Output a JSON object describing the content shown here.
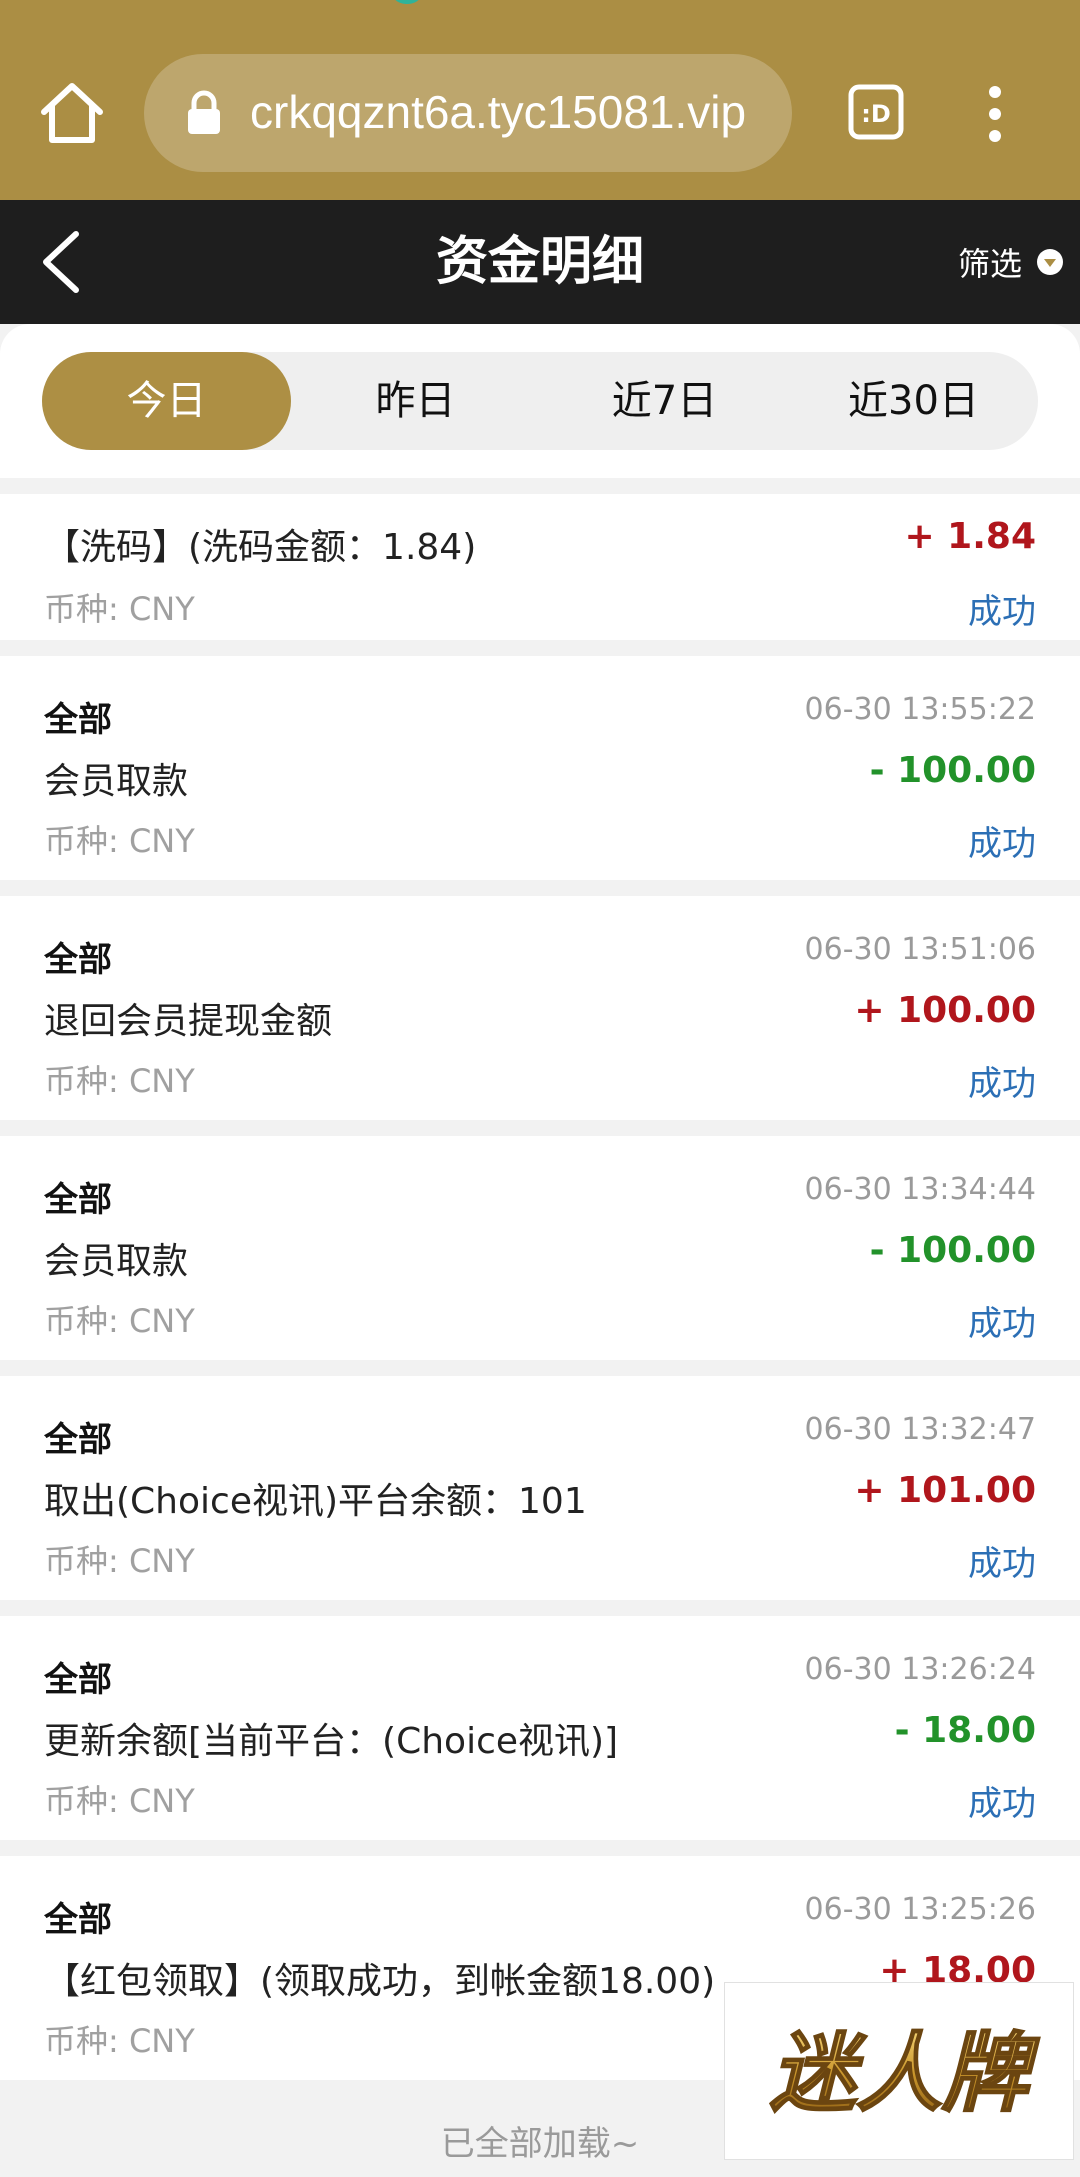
{
  "browser": {
    "url": "crkqqznt6a.tyc15081.vip"
  },
  "header": {
    "title": "资金明细",
    "filter_label": "筛选"
  },
  "tabs": [
    {
      "label": "今日",
      "active": true
    },
    {
      "label": "昨日",
      "active": false
    },
    {
      "label": "近7日",
      "active": false
    },
    {
      "label": "近30日",
      "active": false
    }
  ],
  "records": [
    {
      "type": "",
      "time": "",
      "desc": "【洗码】(洗码金额：1.84)",
      "amount": "+ 1.84",
      "sign": "pos",
      "currency": "币种: CNY",
      "status": "成功"
    },
    {
      "type": "全部",
      "time": "06-30 13:55:22",
      "desc": "会员取款",
      "amount": "- 100.00",
      "sign": "neg",
      "currency": "币种: CNY",
      "status": "成功"
    },
    {
      "type": "全部",
      "time": "06-30 13:51:06",
      "desc": "退回会员提现金额",
      "amount": "+ 100.00",
      "sign": "pos",
      "currency": "币种: CNY",
      "status": "成功"
    },
    {
      "type": "全部",
      "time": "06-30 13:34:44",
      "desc": "会员取款",
      "amount": "- 100.00",
      "sign": "neg",
      "currency": "币种: CNY",
      "status": "成功"
    },
    {
      "type": "全部",
      "time": "06-30 13:32:47",
      "desc": "取出(Choice视讯)平台余额：101",
      "amount": "+ 101.00",
      "sign": "pos",
      "currency": "币种: CNY",
      "status": "成功"
    },
    {
      "type": "全部",
      "time": "06-30 13:26:24",
      "desc": "更新余额[当前平台：(Choice视讯)]",
      "amount": "- 18.00",
      "sign": "neg",
      "currency": "币种: CNY",
      "status": "成功"
    },
    {
      "type": "全部",
      "time": "06-30 13:25:26",
      "desc": "【红包领取】(领取成功，到帐金额18.00)",
      "amount": "+ 18.00",
      "sign": "pos",
      "currency": "币种: CNY",
      "status": ""
    }
  ],
  "footer": {
    "loaded_text": "已全部加载~"
  },
  "watermark": {
    "text": "迷人牌"
  },
  "colors": {
    "brand_gold": "#ab8e44",
    "header_dark": "#1e1e1e",
    "positive": "#b0161c",
    "negative": "#22922a",
    "status_blue": "#2c6fb5"
  }
}
